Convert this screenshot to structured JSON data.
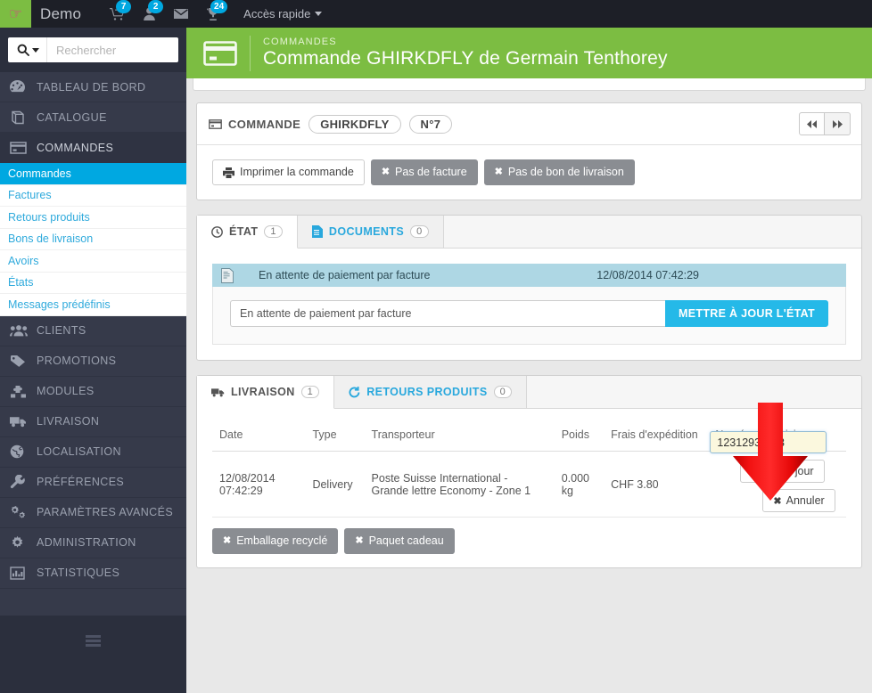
{
  "topbar": {
    "brand": "Demo",
    "icons": [
      {
        "name": "cart-icon",
        "badge": "7"
      },
      {
        "name": "customer-icon",
        "badge": "2"
      },
      {
        "name": "mail-icon",
        "badge": ""
      },
      {
        "name": "trophy-icon",
        "badge": "24"
      }
    ],
    "quick_access": "Accès rapide"
  },
  "search": {
    "placeholder": "Rechercher",
    "value": "",
    "icon": "search-icon"
  },
  "sidebar": {
    "items": [
      {
        "label": "TABLEAU DE BORD",
        "icon": "dashboard-icon",
        "active": false
      },
      {
        "label": "CATALOGUE",
        "icon": "catalog-book-icon",
        "active": false
      },
      {
        "label": "COMMANDES",
        "icon": "orders-card-icon",
        "active": true
      },
      {
        "label": "CLIENTS",
        "icon": "customers-icon",
        "active": false
      },
      {
        "label": "PROMOTIONS",
        "icon": "price-tag-icon",
        "active": false
      },
      {
        "label": "MODULES",
        "icon": "puzzle-icon",
        "active": false
      },
      {
        "label": "LIVRAISON",
        "icon": "truck-icon",
        "active": false
      },
      {
        "label": "LOCALISATION",
        "icon": "globe-icon",
        "active": false
      },
      {
        "label": "PRÉFÉRENCES",
        "icon": "wrench-icon",
        "active": false
      },
      {
        "label": "PARAMÈTRES AVANCÉS",
        "icon": "gears-icon",
        "active": false
      },
      {
        "label": "ADMINISTRATION",
        "icon": "gear-icon",
        "active": false
      },
      {
        "label": "STATISTIQUES",
        "icon": "bar-chart-icon",
        "active": false
      }
    ],
    "submenu": [
      {
        "label": "Commandes",
        "active": true
      },
      {
        "label": "Factures",
        "active": false
      },
      {
        "label": "Retours produits",
        "active": false
      },
      {
        "label": "Bons de livraison",
        "active": false
      },
      {
        "label": "Avoirs",
        "active": false
      },
      {
        "label": "États",
        "active": false
      },
      {
        "label": "Messages prédéfinis",
        "active": false
      }
    ],
    "collapse_icon": "hamburger-icon"
  },
  "page_header": {
    "breadcrumb": "COMMANDES",
    "title": "Commande GHIRKDFLY de Germain Tenthorey",
    "icon": "orders-card-icon",
    "accent_color": "#7cbd42"
  },
  "order_panel": {
    "label": "COMMANDE",
    "reference": "GHIRKDFLY",
    "number": "N°7",
    "prev_label": "◀◀",
    "next_label": "▶▶",
    "buttons": [
      {
        "label": "Imprimer la commande",
        "style": "default",
        "icon": "printer-icon"
      },
      {
        "label": "Pas de facture",
        "style": "grey",
        "icon": "x-icon"
      },
      {
        "label": "Pas de bon de livraison",
        "style": "grey",
        "icon": "x-icon"
      }
    ]
  },
  "status_panel": {
    "tabs": [
      {
        "label": "ÉTAT",
        "count": "1",
        "icon": "clock-icon",
        "active": true
      },
      {
        "label": "DOCUMENTS",
        "count": "0",
        "icon": "document-icon",
        "active": false
      }
    ],
    "current_state": {
      "label": "En attente de paiement par facture",
      "date": "12/08/2014 07:42:29",
      "icon": "invoice-icon",
      "row_color": "#aed7e4"
    },
    "state_select_value": "En attente de paiement par facture",
    "update_button": "METTRE À JOUR L'ÉTAT"
  },
  "shipping_panel": {
    "tabs": [
      {
        "label": "LIVRAISON",
        "count": "1",
        "icon": "truck-icon",
        "active": true
      },
      {
        "label": "RETOURS PRODUITS",
        "count": "0",
        "icon": "refresh-icon",
        "active": false
      }
    ],
    "columns": [
      "Date",
      "Type",
      "Transporteur",
      "Poids",
      "Frais d'expédition",
      "Numéro de suivi"
    ],
    "rows": [
      {
        "date": "12/08/2014 07:42:29",
        "type": "Delivery",
        "carrier": "Poste Suisse International - Grande lettre Economy - Zone 1",
        "weight": "0.000 kg",
        "shipping_cost": "CHF 3.80",
        "tracking_number": "12312931123"
      }
    ],
    "tracking_update_label": "Mettre à jour",
    "tracking_cancel_label": "Annuler",
    "footer_buttons": [
      {
        "label": "Emballage recyclé",
        "style": "grey",
        "icon": "x-icon"
      },
      {
        "label": "Paquet cadeau",
        "style": "grey",
        "icon": "x-icon"
      }
    ]
  },
  "overlay": {
    "arrow": "red-down-arrow",
    "arrow_color": "#e51d1d"
  }
}
